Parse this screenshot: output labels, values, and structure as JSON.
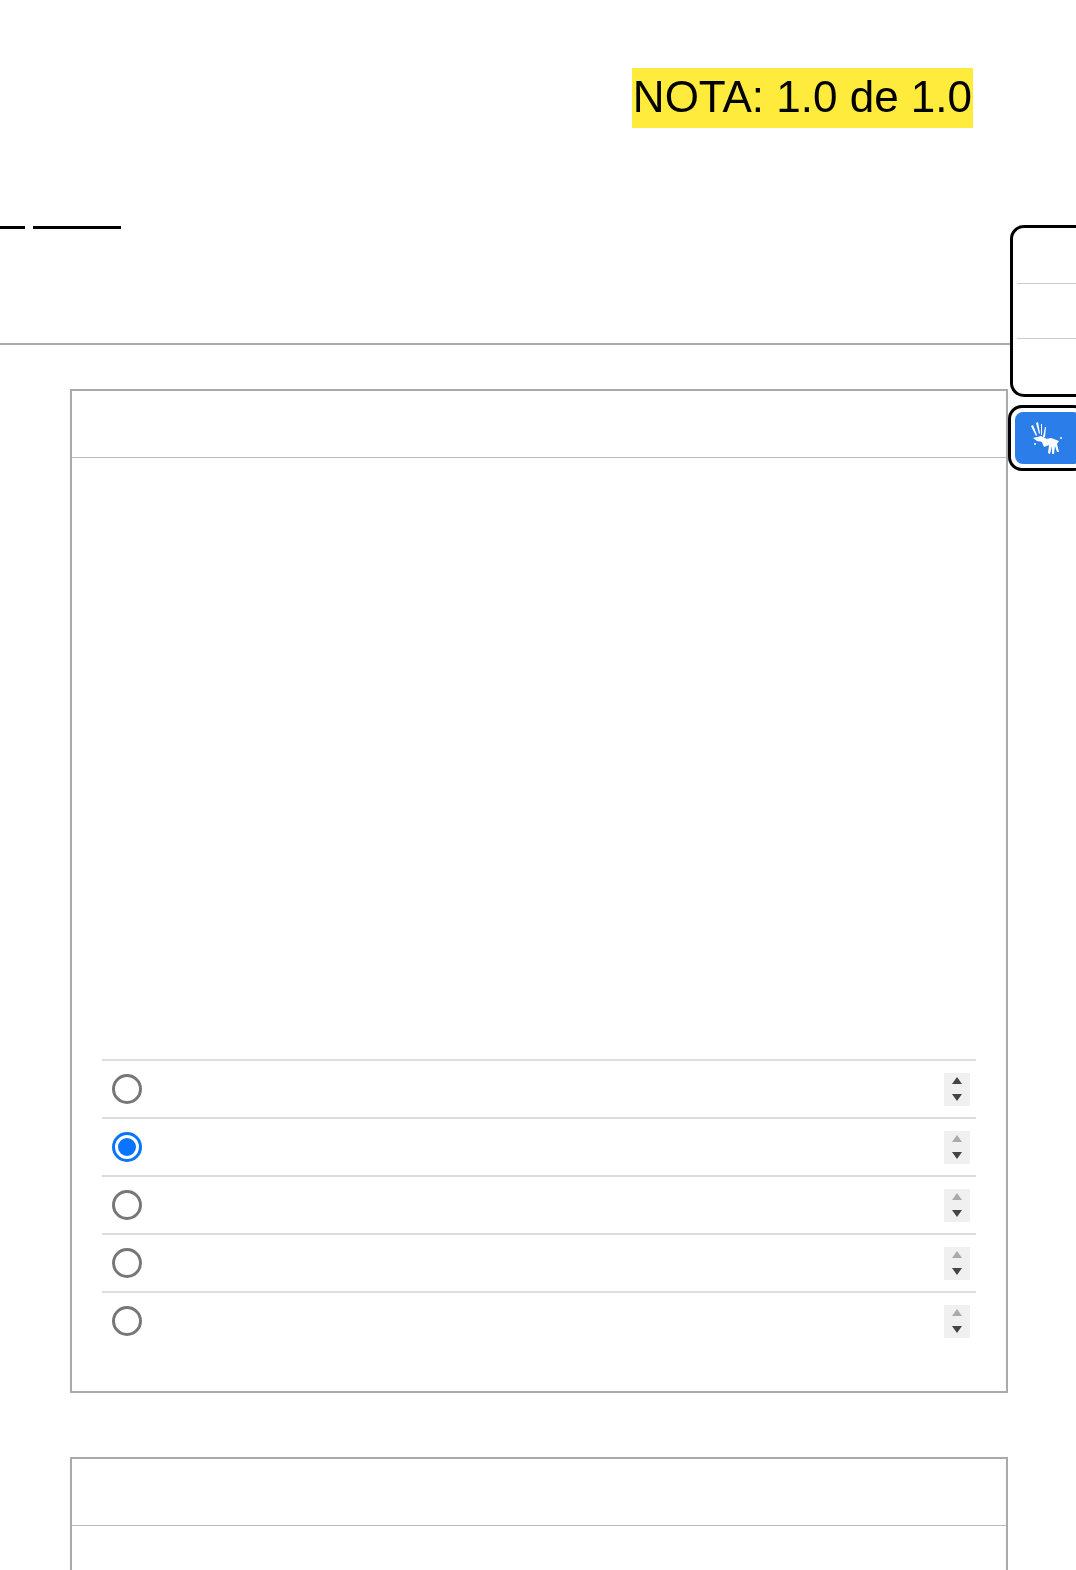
{
  "grade": {
    "text": "NOTA: 1.0 de 1.0"
  },
  "question": {
    "options": [
      {
        "selected": false,
        "move_up_disabled": false
      },
      {
        "selected": true,
        "move_up_disabled": true
      },
      {
        "selected": false,
        "move_up_disabled": true
      },
      {
        "selected": false,
        "move_up_disabled": true
      },
      {
        "selected": false,
        "move_up_disabled": true
      }
    ]
  }
}
